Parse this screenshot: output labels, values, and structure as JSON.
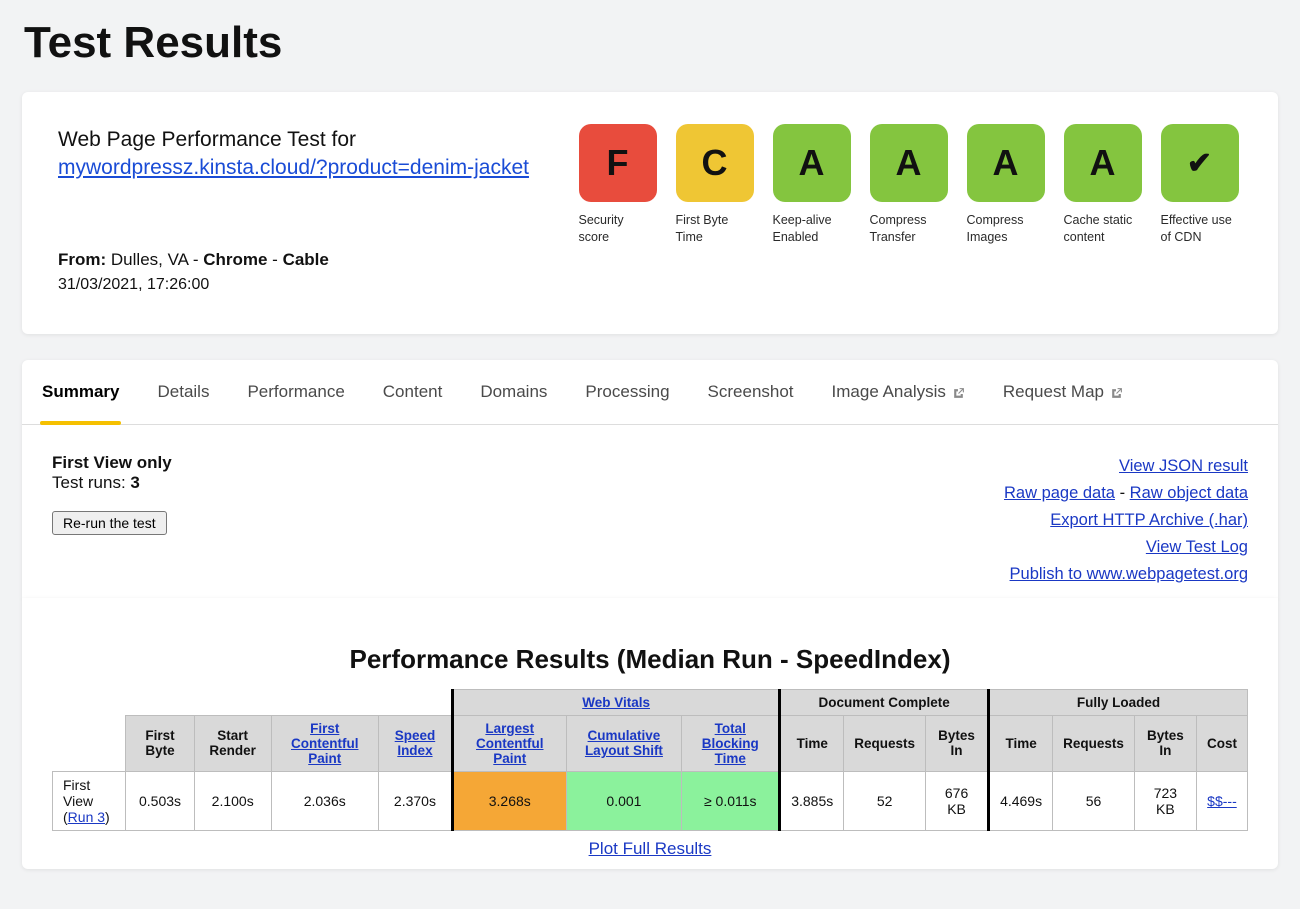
{
  "page_title": "Test Results",
  "intro": "Web Page Performance Test for",
  "test_url": "mywordpressz.kinsta.cloud/?product=denim-jacket",
  "from_label": "From:",
  "from_location": "Dulles, VA",
  "from_browser": "Chrome",
  "from_connection": "Cable",
  "timestamp": "31/03/2021, 17:26:00",
  "grades": {
    "security": {
      "grade": "F",
      "label": "Security score"
    },
    "first_byte": {
      "grade": "C",
      "label": "First Byte Time"
    },
    "keepalive": {
      "grade": "A",
      "label": "Keep-alive Enabled"
    },
    "compress_transfer": {
      "grade": "A",
      "label": "Compress Transfer"
    },
    "compress_images": {
      "grade": "A",
      "label": "Compress Images"
    },
    "cache_static": {
      "grade": "A",
      "label": "Cache static content"
    },
    "cdn": {
      "grade": "✔",
      "label": "Effective use of CDN"
    }
  },
  "tabs": {
    "summary": "Summary",
    "details": "Details",
    "performance": "Performance",
    "content": "Content",
    "domains": "Domains",
    "processing": "Processing",
    "screenshot": "Screenshot",
    "image_analysis": "Image Analysis",
    "request_map": "Request Map"
  },
  "body": {
    "first_view_only": "First View only",
    "test_runs_label": "Test runs: ",
    "test_runs_value": "3",
    "rerun": "Re-run the test",
    "links": {
      "view_json": "View JSON result",
      "raw_page": "Raw page data",
      "raw_object": "Raw object data",
      "export_har": "Export HTTP Archive (.har)",
      "view_log": "View Test Log",
      "publish": "Publish to www.webpagetest.org"
    }
  },
  "perf": {
    "title": "Performance Results (Median Run - SpeedIndex)",
    "groups": {
      "web_vitals": "Web Vitals",
      "doc_complete": "Document Complete",
      "fully_loaded": "Fully Loaded"
    },
    "columns": {
      "first_byte": "First Byte",
      "start_render": "Start Render",
      "fcp": "First Contentful Paint",
      "speed_index": "Speed Index",
      "lcp": "Largest Contentful Paint",
      "cls": "Cumulative Layout Shift",
      "tbt": "Total Blocking Time",
      "time": "Time",
      "requests": "Requests",
      "bytes_in": "Bytes In",
      "cost": "Cost"
    },
    "row": {
      "label_prefix": "First View (",
      "run_link": "Run 3",
      "label_suffix": ")",
      "first_byte": "0.503s",
      "start_render": "2.100s",
      "fcp": "2.036s",
      "speed_index": "2.370s",
      "lcp": "3.268s",
      "cls": "0.001",
      "tbt": "≥ 0.011s",
      "dc_time": "3.885s",
      "dc_requests": "52",
      "dc_bytes": "676 KB",
      "fl_time": "4.469s",
      "fl_requests": "56",
      "fl_bytes": "723 KB",
      "cost": "$$---"
    },
    "plot_link": "Plot Full Results"
  }
}
